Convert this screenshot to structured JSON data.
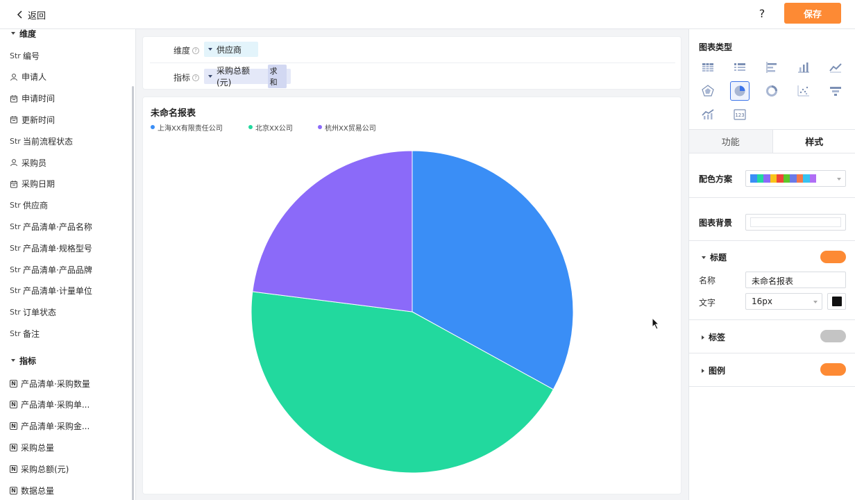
{
  "header": {
    "back_label": "返回",
    "help_label": "?",
    "save_label": "保存"
  },
  "left_panel": {
    "dimension_group": "维度",
    "dimensions": [
      {
        "type": "str",
        "label": "编号"
      },
      {
        "type": "user",
        "label": "申请人"
      },
      {
        "type": "date",
        "label": "申请时间"
      },
      {
        "type": "date",
        "label": "更新时间"
      },
      {
        "type": "str",
        "label": "当前流程状态"
      },
      {
        "type": "user",
        "label": "采购员"
      },
      {
        "type": "date",
        "label": "采购日期"
      },
      {
        "type": "str",
        "label": "供应商"
      },
      {
        "type": "str",
        "label": "产品清单·产品名称"
      },
      {
        "type": "str",
        "label": "产品清单·规格型号"
      },
      {
        "type": "str",
        "label": "产品清单·产品品牌"
      },
      {
        "type": "str",
        "label": "产品清单·计量单位"
      },
      {
        "type": "str",
        "label": "订单状态"
      },
      {
        "type": "str",
        "label": "备注"
      }
    ],
    "measure_group": "指标",
    "measures": [
      {
        "type": "num",
        "label": "产品清单·采购数量"
      },
      {
        "type": "num",
        "label": "产品清单·采购单..."
      },
      {
        "type": "num",
        "label": "产品清单·采购金..."
      },
      {
        "type": "num",
        "label": "采购总量"
      },
      {
        "type": "num",
        "label": "采购总额(元)"
      },
      {
        "type": "num",
        "label": "数据总量"
      }
    ],
    "str_icon_text": "Str",
    "num_icon_text": "N"
  },
  "config": {
    "dimension_label": "维度",
    "dimension_value": "供应商",
    "measure_label": "指标",
    "measure_value": "采购总额(元)",
    "measure_agg": "求和"
  },
  "chart_data": {
    "type": "pie",
    "title": "未命名报表",
    "legend_position": "top-left",
    "slices": [
      {
        "name": "上海XX有限责任公司",
        "value": 33,
        "color": "#3a8ef6"
      },
      {
        "name": "北京XX公司",
        "value": 44,
        "color": "#22d99e"
      },
      {
        "name": "杭州XX贸易公司",
        "value": 23,
        "color": "#8b6af9"
      }
    ]
  },
  "right_panel": {
    "chart_type_title": "图表类型",
    "chart_types": [
      {
        "icon": "table-icon",
        "active": false
      },
      {
        "icon": "list-icon",
        "active": false
      },
      {
        "icon": "bar-horizontal-icon",
        "active": false
      },
      {
        "icon": "bar-vertical-icon",
        "active": false
      },
      {
        "icon": "line-chart-icon",
        "active": false
      },
      {
        "icon": "radar-icon",
        "active": false
      },
      {
        "icon": "pie-icon",
        "active": true
      },
      {
        "icon": "donut-icon",
        "active": false
      },
      {
        "icon": "scatter-icon",
        "active": false
      },
      {
        "icon": "funnel-icon",
        "active": false
      },
      {
        "icon": "combo-icon",
        "active": false
      },
      {
        "icon": "indicator-icon",
        "active": false
      }
    ],
    "indicator_icon_text": "123",
    "tab_function": "功能",
    "tab_style": "样式",
    "color_scheme_label": "配色方案",
    "color_scheme": [
      "#3a8ef6",
      "#22d99e",
      "#8b6af9",
      "#f9c41a",
      "#f0453a",
      "#5ec72a",
      "#6b7ae8",
      "#f4794a",
      "#37c3f2",
      "#b06ef5"
    ],
    "chart_bg_label": "图表背景",
    "title_section": "标题",
    "title_toggle_on": true,
    "name_label": "名称",
    "name_value": "未命名报表",
    "text_label": "文字",
    "font_size_value": "16px",
    "text_color": "#111111",
    "label_section": "标签",
    "label_toggle_on": false,
    "legend_section": "图例",
    "legend_toggle_on": true
  }
}
